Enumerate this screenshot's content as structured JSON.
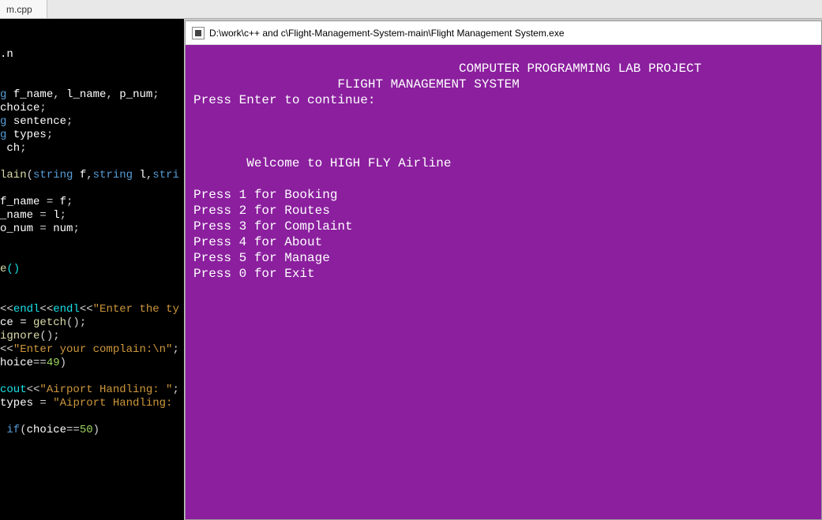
{
  "tab": {
    "label": "m.cpp"
  },
  "editor": {
    "lines": [
      {
        "raw": "",
        "tokens": []
      },
      {
        "raw": "",
        "tokens": [
          [
            ".n",
            "kw-white"
          ]
        ]
      },
      {
        "raw": "",
        "tokens": []
      },
      {
        "raw": "",
        "tokens": []
      },
      {
        "raw": "",
        "tokens": [
          [
            "g ",
            "kw-blue"
          ],
          [
            "f_name",
            "kw-white"
          ],
          [
            ", ",
            "kw-op"
          ],
          [
            "l_name",
            "kw-white"
          ],
          [
            ", ",
            "kw-op"
          ],
          [
            "p_num",
            "kw-white"
          ],
          [
            ";",
            "kw-op"
          ]
        ]
      },
      {
        "raw": "",
        "tokens": [
          [
            "choice",
            "kw-white"
          ],
          [
            ";",
            "kw-op"
          ]
        ]
      },
      {
        "raw": "",
        "tokens": [
          [
            "g ",
            "kw-blue"
          ],
          [
            "sentence",
            "kw-white"
          ],
          [
            ";",
            "kw-op"
          ]
        ]
      },
      {
        "raw": "",
        "tokens": [
          [
            "g ",
            "kw-blue"
          ],
          [
            "types",
            "kw-white"
          ],
          [
            ";",
            "kw-op"
          ]
        ]
      },
      {
        "raw": "",
        "tokens": [
          [
            " ch",
            "kw-white"
          ],
          [
            ";",
            "kw-op"
          ]
        ]
      },
      {
        "raw": "",
        "tokens": []
      },
      {
        "raw": "",
        "tokens": [
          [
            "lain",
            "kw-func"
          ],
          [
            "(",
            "kw-op"
          ],
          [
            "string",
            "kw-blue"
          ],
          [
            " f",
            "kw-white"
          ],
          [
            ",",
            "kw-op"
          ],
          [
            "string",
            "kw-blue"
          ],
          [
            " l",
            "kw-white"
          ],
          [
            ",",
            "kw-op"
          ],
          [
            "stri",
            "kw-blue"
          ]
        ]
      },
      {
        "raw": "",
        "tokens": []
      },
      {
        "raw": "",
        "tokens": [
          [
            "f_name",
            "kw-white"
          ],
          [
            " = ",
            "kw-op"
          ],
          [
            "f",
            "kw-white"
          ],
          [
            ";",
            "kw-op"
          ]
        ]
      },
      {
        "raw": "",
        "tokens": [
          [
            "_name",
            "kw-white"
          ],
          [
            " = ",
            "kw-op"
          ],
          [
            "l",
            "kw-white"
          ],
          [
            ";",
            "kw-op"
          ]
        ]
      },
      {
        "raw": "",
        "tokens": [
          [
            "o_num",
            "kw-white"
          ],
          [
            " = ",
            "kw-op"
          ],
          [
            "num",
            "kw-white"
          ],
          [
            ";",
            "kw-op"
          ]
        ]
      },
      {
        "raw": "",
        "tokens": []
      },
      {
        "raw": "",
        "tokens": []
      },
      {
        "raw": "",
        "tokens": [
          [
            "e",
            "kw-func"
          ],
          [
            "()",
            "kw-type"
          ]
        ]
      },
      {
        "raw": "",
        "tokens": []
      },
      {
        "raw": "",
        "tokens": []
      },
      {
        "raw": "",
        "tokens": [
          [
            "<<",
            "kw-op"
          ],
          [
            "endl",
            "kw-type"
          ],
          [
            "<<",
            "kw-op"
          ],
          [
            "endl",
            "kw-type"
          ],
          [
            "<<",
            "kw-op"
          ],
          [
            "\"Enter the ty",
            "kw-str"
          ]
        ]
      },
      {
        "raw": "",
        "tokens": [
          [
            "ce = ",
            "kw-white"
          ],
          [
            "getch",
            "kw-func"
          ],
          [
            "();",
            "kw-op"
          ]
        ]
      },
      {
        "raw": "",
        "tokens": [
          [
            "ignore",
            "kw-func"
          ],
          [
            "();",
            "kw-op"
          ]
        ]
      },
      {
        "raw": "",
        "tokens": [
          [
            "<<",
            "kw-op"
          ],
          [
            "\"Enter your complain:\\n\"",
            "kw-str"
          ],
          [
            ";",
            "kw-op"
          ]
        ]
      },
      {
        "raw": "",
        "tokens": [
          [
            "hoice",
            "kw-white"
          ],
          [
            "==",
            "kw-op"
          ],
          [
            "49",
            "kw-num"
          ],
          [
            ")",
            "kw-op"
          ]
        ]
      },
      {
        "raw": "",
        "tokens": []
      },
      {
        "raw": "",
        "tokens": [
          [
            "cout",
            "kw-type"
          ],
          [
            "<<",
            "kw-op"
          ],
          [
            "\"Airport Handling: \"",
            "kw-str"
          ],
          [
            ";",
            "kw-op"
          ]
        ]
      },
      {
        "raw": "",
        "tokens": [
          [
            "types",
            "kw-white"
          ],
          [
            " = ",
            "kw-op"
          ],
          [
            "\"Aiprort Handling: ",
            "kw-str"
          ]
        ]
      },
      {
        "raw": "",
        "tokens": []
      },
      {
        "raw": "",
        "tokens": [
          [
            " if",
            "kw-if"
          ],
          [
            "(",
            "kw-op"
          ],
          [
            "choice",
            "kw-white"
          ],
          [
            "==",
            "kw-op"
          ],
          [
            "50",
            "kw-num"
          ],
          [
            ")",
            "kw-op"
          ]
        ]
      }
    ]
  },
  "console": {
    "icon_name": "app-icon",
    "title": "D:\\work\\c++ and c\\Flight-Management-System-main\\Flight Management System.exe",
    "header_center": "                                   COMPUTER PROGRAMMING LAB PROJECT",
    "subtitle": "                   FLIGHT MANAGEMENT SYSTEM",
    "prompt_continue": "Press Enter to continue:",
    "welcome_line": "       Welcome to HIGH FLY Airline",
    "menu": [
      "Press 1 for Booking",
      "Press 2 for Routes",
      "Press 3 for Complaint",
      "Press 4 for About",
      "Press 5 for Manage",
      "Press 0 for Exit"
    ]
  }
}
